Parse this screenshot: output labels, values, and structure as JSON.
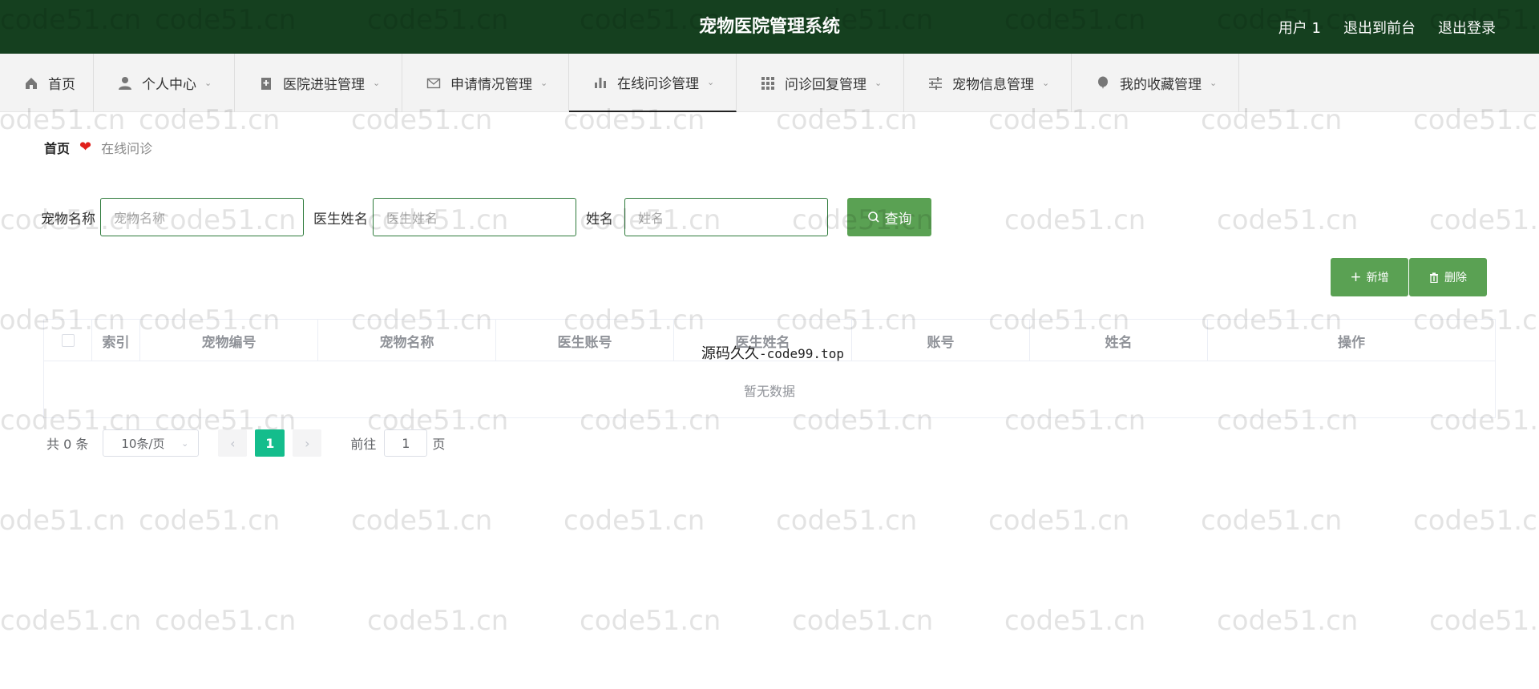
{
  "header": {
    "title": "宠物医院管理系统",
    "user": "用户 1",
    "exit_front": "退出到前台",
    "logout": "退出登录"
  },
  "nav": {
    "items": [
      {
        "label": "首页",
        "icon": "home-icon",
        "chevron": false
      },
      {
        "label": "个人中心",
        "icon": "user-icon",
        "chevron": true
      },
      {
        "label": "医院进驻管理",
        "icon": "hospital-icon",
        "chevron": true
      },
      {
        "label": "申请情况管理",
        "icon": "mail-icon",
        "chevron": true
      },
      {
        "label": "在线问诊管理",
        "icon": "bar-chart-icon",
        "chevron": true,
        "active": true
      },
      {
        "label": "问诊回复管理",
        "icon": "grid-icon",
        "chevron": true
      },
      {
        "label": "宠物信息管理",
        "icon": "sliders-icon",
        "chevron": true
      },
      {
        "label": "我的收藏管理",
        "icon": "balloon-icon",
        "chevron": true
      }
    ]
  },
  "breadcrumb": {
    "home": "首页",
    "current": "在线问诊",
    "separator_icon": "heart-icon",
    "separator_color": "#e0201c"
  },
  "search": {
    "pet_name_label": "宠物名称",
    "pet_name_placeholder": "宠物名称",
    "doctor_name_label": "医生姓名",
    "doctor_name_placeholder": "医生姓名",
    "name_label": "姓名",
    "name_placeholder": "姓名",
    "query_button": "查询"
  },
  "actions": {
    "add": "新增",
    "delete": "删除"
  },
  "table": {
    "columns": [
      "索引",
      "宠物编号",
      "宠物名称",
      "医生账号",
      "医生姓名",
      "账号",
      "姓名",
      "操作"
    ],
    "empty_text": "暂无数据"
  },
  "pagination": {
    "total": "共 0 条",
    "page_size": "10条/页",
    "current_page": "1",
    "goto_label": "前往",
    "goto_value": "1",
    "page_suffix": "页"
  },
  "overlay": {
    "prefix": "源码久久",
    "suffix": "-code99.top"
  },
  "watermark": "code51.cn",
  "colors": {
    "header_bg": "#15401f",
    "accent_green": "#5aa153",
    "page_active": "#14bd8c"
  }
}
